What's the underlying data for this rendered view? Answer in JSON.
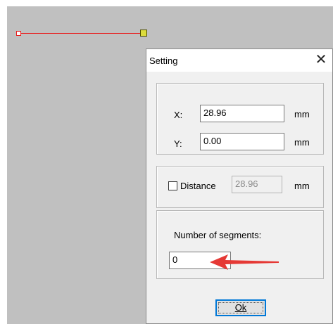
{
  "dialog": {
    "title": "Setting",
    "close_glyph": "✕",
    "coords": {
      "x_label": "X:",
      "x_value": "28.96",
      "x_unit": "mm",
      "y_label": "Y:",
      "y_value": "0.00",
      "y_unit": "mm"
    },
    "distance": {
      "label": "Distance",
      "checked": false,
      "value": "28.96",
      "unit": "mm"
    },
    "segments": {
      "label": "Number of segments:",
      "value": "0"
    },
    "ok_label": "Ok"
  },
  "colors": {
    "canvas": "#c0c0c0",
    "line": "#e81e1e",
    "end_handle": "#dcdc3c",
    "annotation_arrow": "#e53935",
    "button_focus": "#0078d7"
  },
  "icons": {
    "close": "close-icon",
    "annotation": "red-arrow-icon"
  }
}
